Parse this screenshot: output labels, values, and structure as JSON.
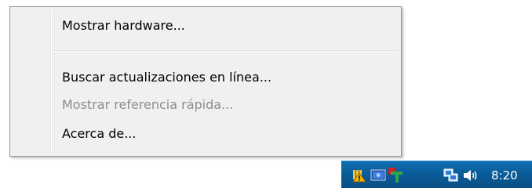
{
  "context_menu": {
    "items": [
      {
        "label": "Mostrar hardware...",
        "enabled": true
      },
      {
        "label": "Buscar actualizaciones en línea...",
        "enabled": true
      },
      {
        "label": "Mostrar referencia rápida...",
        "enabled": false
      },
      {
        "label": "Acerca de...",
        "enabled": true
      }
    ]
  },
  "taskbar": {
    "clock_text": "8:20",
    "tray_icons": [
      "security-warning-icon",
      "monitor-icon",
      "app-t-icon",
      "network-icon",
      "volume-icon"
    ]
  },
  "colors": {
    "menu_background": "#f0f0f0",
    "menu_border": "#979797",
    "disabled_text": "#8d8d8d",
    "taskbar": "#0a5c98"
  }
}
